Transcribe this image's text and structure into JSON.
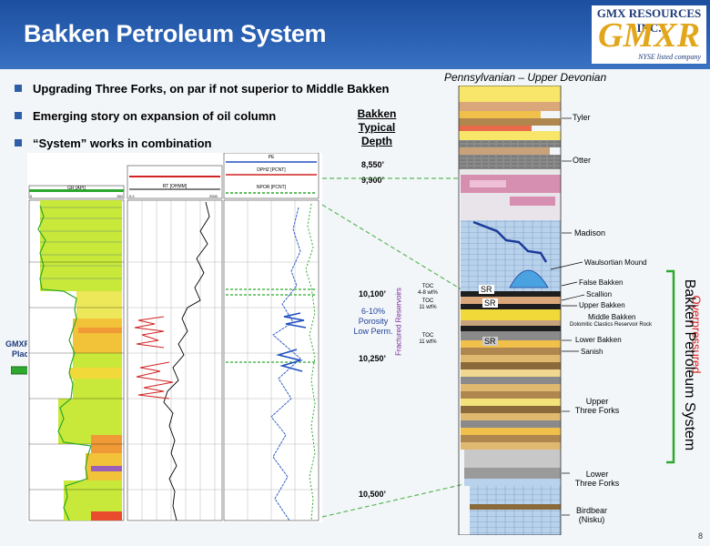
{
  "header": {
    "title": "Bakken Petroleum System"
  },
  "logo": {
    "company": "GMX RESOURCES INC.",
    "brand": "GMXR",
    "tagline": "NYSE listed company"
  },
  "bullets": [
    "Upgrading Three Forks, on par if not superior to Middle Bakken",
    "Emerging story on expansion of oil column",
    "“System” works in combination"
  ],
  "column_label": "Pennsylvanian – Upper Devonian",
  "typical_depth": {
    "line1": "Bakken",
    "line2": "Typical",
    "line3": "Depth"
  },
  "depths": [
    "8,550’",
    "9,900’",
    "10,100’",
    "10,250’",
    "10,500’"
  ],
  "toc": [
    {
      "line1": "TOC",
      "line2": "4-8 wt%"
    },
    {
      "line1": "TOC",
      "line2": "11 wt%"
    },
    {
      "line1": "TOC",
      "line2": "11 wt%"
    }
  ],
  "porosity": {
    "line1": "6-10%",
    "line2": "Porosity",
    "line3": "Low Perm."
  },
  "fractured": "Fractured Reservoirs",
  "lateral": {
    "line1": "GMXR Lateral",
    "line2": "Placement"
  },
  "formations": {
    "tyler": "Tyler",
    "otter": "Otter",
    "madison": "Madison",
    "waulsortian": "Waulsortian Mound",
    "false_bakken": "False Bakken",
    "scallion": "Scallion",
    "upper_bakken": "Upper Bakken",
    "middle_bakken": "Middle Bakken",
    "middle_bakken_sub": "Dolomitic Clastics Reservoir Rock",
    "lower_bakken": "Lower Bakken",
    "sanish": "Sanish",
    "upper_tf_1": "Upper",
    "upper_tf_2": "Three Forks",
    "lower_tf_1": "Lower",
    "lower_tf_2": "Three Forks",
    "birdbear_1": "Birdbear",
    "birdbear_2": "(Nisku)"
  },
  "sr": [
    "SR",
    "SR",
    "SR"
  ],
  "overpressured": "Overpressured",
  "system_label": "Bakken Petroleum System",
  "log_tracks": {
    "gr": "GR [API]",
    "gr_min": "0",
    "gr_max": "150",
    "rt": "RT [OHMM]",
    "rt_min": "0.2",
    "rt_max": "2000",
    "pe_top": "PE",
    "dphz": "DPHZ [PCNT]",
    "npor": "NPOR [PCNT]"
  },
  "page_number": "8",
  "colors": {
    "header": "#2c63b5",
    "accent": "#e2a61a",
    "red": "#d22222",
    "green": "#2ea82e"
  }
}
